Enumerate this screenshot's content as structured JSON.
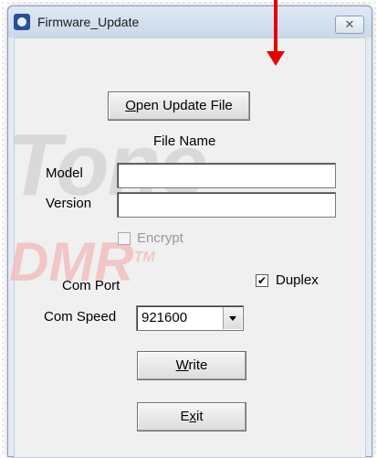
{
  "window": {
    "title": "Firmware_Update",
    "close_label": "✕"
  },
  "buttons": {
    "open_update_file": {
      "before": "",
      "mnemonic": "O",
      "after": "pen Update File"
    },
    "write": {
      "before": "",
      "mnemonic": "W",
      "after": "rite"
    },
    "exit": {
      "before": "E",
      "mnemonic": "x",
      "after": "it"
    }
  },
  "labels": {
    "file_name": "File Name",
    "model": "Model",
    "version": "Version",
    "encrypt": "Encrypt",
    "com_port": "Com Port",
    "duplex": "Duplex",
    "com_speed": "Com Speed"
  },
  "fields": {
    "model_value": "",
    "version_value": ""
  },
  "checkboxes": {
    "encrypt_checked": false,
    "duplex_checked": true,
    "check_mark": "✔"
  },
  "com_speed": {
    "selected": "921600"
  },
  "watermark": {
    "brand_text": "Tone",
    "dmr_text": "DMR",
    "tm": "TM"
  },
  "colors": {
    "annotation_arrow": "#e60000"
  }
}
